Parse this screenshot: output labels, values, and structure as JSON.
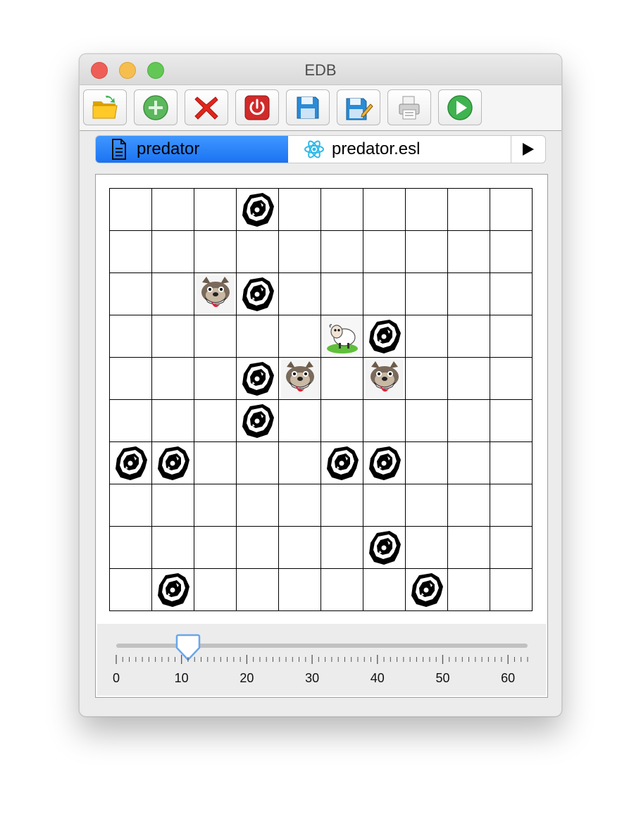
{
  "window": {
    "title": "EDB"
  },
  "toolbar": {
    "buttons": [
      {
        "name": "open-button",
        "icon": "folder-open-icon"
      },
      {
        "name": "add-button",
        "icon": "plus-circle-icon"
      },
      {
        "name": "delete-button",
        "icon": "red-x-icon"
      },
      {
        "name": "power-button",
        "icon": "power-icon"
      },
      {
        "name": "save-button",
        "icon": "floppy-disk-icon"
      },
      {
        "name": "save-as-button",
        "icon": "floppy-pencil-icon"
      },
      {
        "name": "print-button",
        "icon": "printer-icon"
      },
      {
        "name": "run-button",
        "icon": "play-circle-icon"
      }
    ]
  },
  "tabs": [
    {
      "label": "predator",
      "icon": "document-icon",
      "selected": true
    },
    {
      "label": "predator.esl",
      "icon": "atom-icon",
      "selected": false
    }
  ],
  "grid": {
    "rows": 10,
    "cols": 10,
    "cells": [
      ".  .  .  R  .  .  .  .  .  .",
      ".  .  .  .  .  .  .  .  .  .",
      ".  .  W  R  .  .  .  .  .  .",
      ".  .  .  .  .  S  R  .  .  .",
      ".  .  .  R  W  .  W  .  .  .",
      ".  .  .  R  .  .  .  .  .  .",
      "R  R  .  .  .  R  R  .  .  .",
      ".  .  .  .  .  .  .  .  .  .",
      ".  .  .  .  .  .  R  .  .  .",
      ".  R  .  .  .  .  .  R  .  ."
    ],
    "legend": {
      "R": "rock-icon",
      "W": "wolf-icon",
      "S": "sheep-icon"
    }
  },
  "slider": {
    "min": 0,
    "max": 63,
    "value": 11,
    "tick_labels": [
      "0",
      "10",
      "20",
      "30",
      "40",
      "50",
      "60"
    ]
  }
}
